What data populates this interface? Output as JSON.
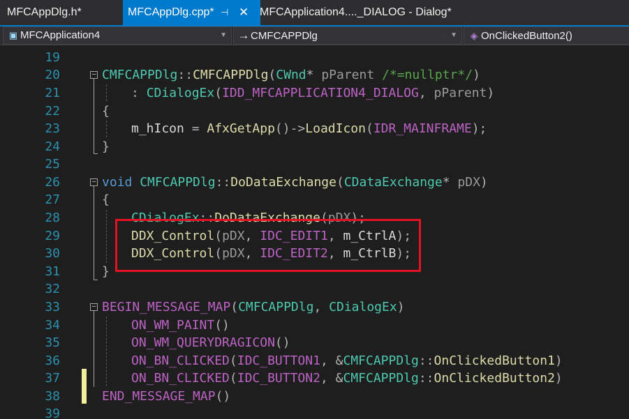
{
  "tabs": [
    {
      "label": "MFCAppDlg.h*",
      "active": false
    },
    {
      "label": "MFCAppDlg.cpp*",
      "active": true,
      "pin": "⊣",
      "close": "✕"
    },
    {
      "label": "MFCApplication4...._DIALOG - Dialog*",
      "active": false
    }
  ],
  "nav": {
    "project": {
      "label": "MFCApplication4",
      "icon": "project-icon"
    },
    "scope": {
      "label": "CMFCAPPDlg",
      "icon": "arrow-right-icon"
    },
    "member": {
      "label": "OnClickedButton2()",
      "icon": "method-cube-icon"
    }
  },
  "colors": {
    "accent": "#007acc",
    "highlight_box": "#e81123",
    "change_marker": "#efef9e",
    "line_number": "#2b91af"
  },
  "editor": {
    "line_numbers": [
      "19",
      "20",
      "21",
      "22",
      "23",
      "24",
      "25",
      "26",
      "27",
      "28",
      "29",
      "30",
      "31",
      "32",
      "33",
      "34",
      "35",
      "36",
      "37",
      "38",
      "39"
    ],
    "lines": {
      "l20": {
        "cls": "CMFCAPPDlg",
        "sep": "::",
        "ctor": "CMFCAPPDlg",
        "open": "(",
        "ptype": "CWnd",
        "star": "*",
        "pname": " pParent",
        "cmt": " /*=nullptr*/",
        "close": ")"
      },
      "l21": {
        "colon": ": ",
        "base": "CDialogEx",
        "open": "(",
        "arg1": "IDD_MFCAPPLICATION4_DIALOG",
        "comma": ", ",
        "arg2": "pParent",
        "close": ")"
      },
      "l22": {
        "brace": "{"
      },
      "l23": {
        "lhs": "m_hIcon",
        "eq": " = ",
        "fn1": "AfxGetApp",
        "p1": "()->",
        "fn2": "LoadIcon",
        "open": "(",
        "arg": "IDR_MAINFRAME",
        "close": ");"
      },
      "l24": {
        "brace": "}"
      },
      "l26": {
        "kw": "void",
        "cls": " CMFCAPPDlg",
        "sep": "::",
        "fn": "DoDataExchange",
        "open": "(",
        "ptype": "CDataExchange",
        "star": "*",
        "pname": " pDX",
        "close": ")"
      },
      "l27": {
        "brace": "{"
      },
      "l28": {
        "cls": "CDialogEx",
        "sep": "::",
        "fn": "DoDataExchange",
        "open": "(",
        "arg": "pDX",
        "close": ");"
      },
      "l29": {
        "fn": "DDX_Control",
        "open": "(",
        "a1": "pDX",
        "c1": ", ",
        "a2": "IDC_EDIT1",
        "c2": ", ",
        "a3": "m_CtrlA",
        "close": ");"
      },
      "l30": {
        "fn": "DDX_Control",
        "open": "(",
        "a1": "pDX",
        "c1": ", ",
        "a2": "IDC_EDIT2",
        "c2": ", ",
        "a3": "m_CtrlB",
        "close": ");"
      },
      "l31": {
        "brace": "}"
      },
      "l33": {
        "mac": "BEGIN_MESSAGE_MAP",
        "open": "(",
        "a1": "CMFCAPPDlg",
        "c1": ", ",
        "a2": "CDialogEx",
        "close": ")"
      },
      "l34": {
        "mac": "ON_WM_PAINT",
        "p": "()"
      },
      "l35": {
        "mac": "ON_WM_QUERYDRAGICON",
        "p": "()"
      },
      "l36": {
        "mac": "ON_BN_CLICKED",
        "open": "(",
        "id": "IDC_BUTTON1",
        "c1": ", &",
        "cls": "CMFCAPPDlg",
        "sep": "::",
        "fn": "OnClickedButton1",
        "close": ")"
      },
      "l37": {
        "mac": "ON_BN_CLICKED",
        "open": "(",
        "id": "IDC_BUTTON2",
        "c1": ", &",
        "cls": "CMFCAPPDlg",
        "sep": "::",
        "fn": "OnClickedButton2",
        "close": ")"
      },
      "l38": {
        "mac": "END_MESSAGE_MAP",
        "p": "()"
      }
    }
  }
}
